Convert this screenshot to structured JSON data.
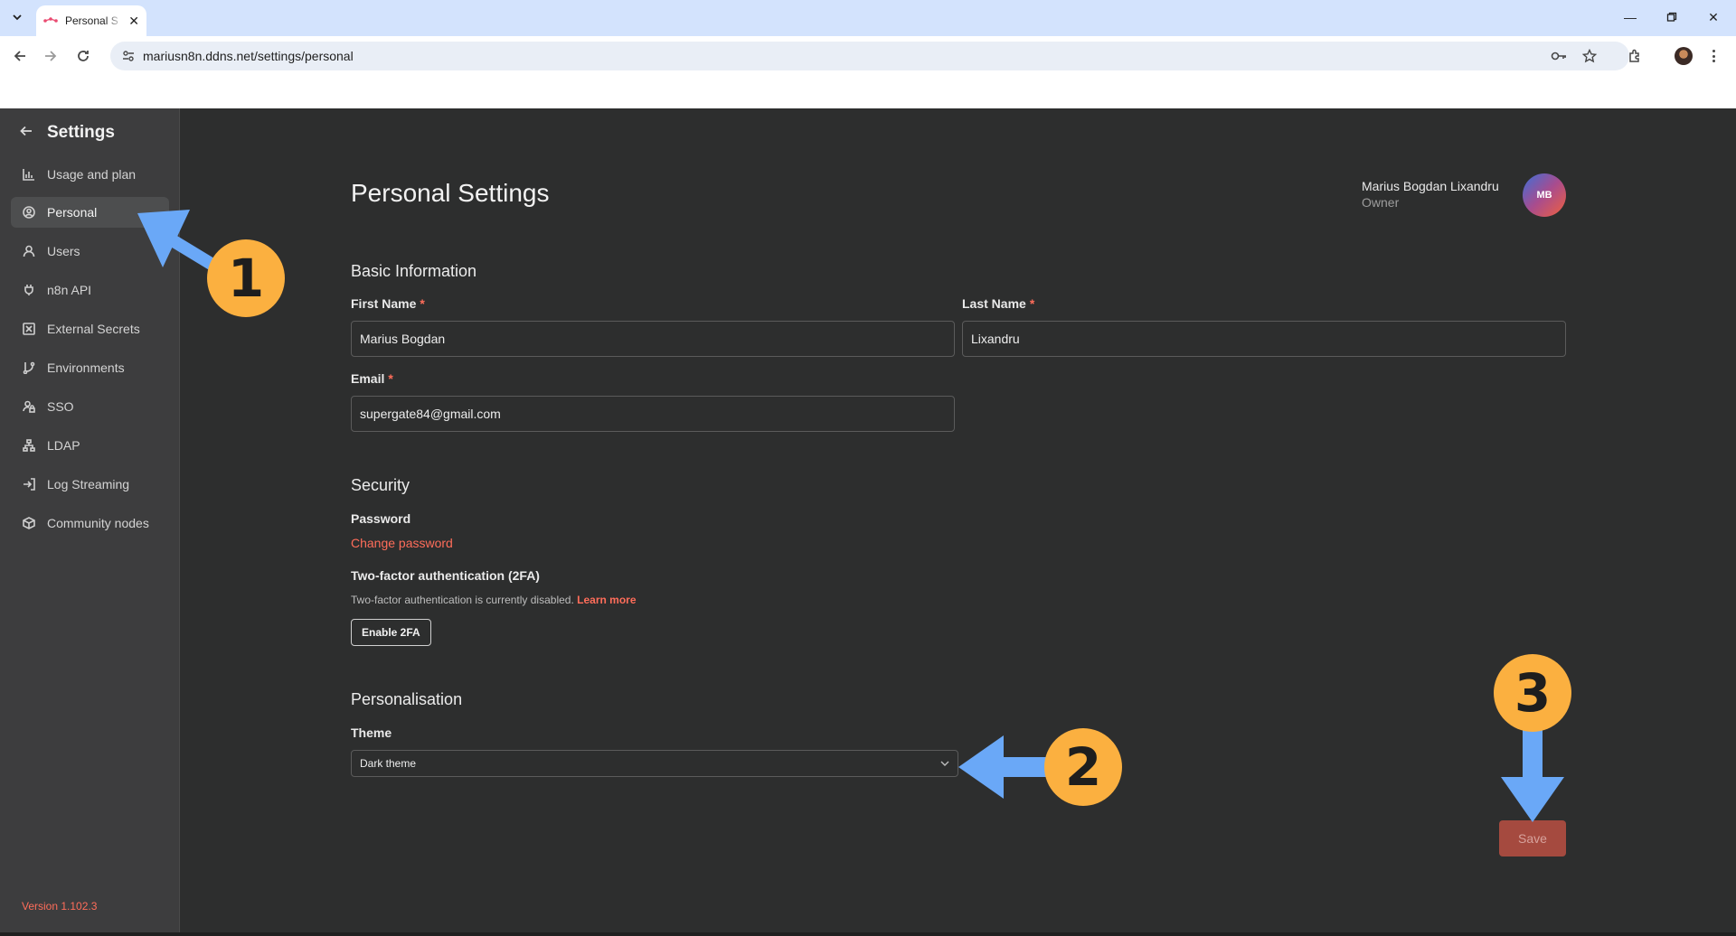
{
  "browser": {
    "tab_title": "Personal S",
    "url": "mariusn8n.ddns.net/settings/personal"
  },
  "sidebar": {
    "title": "Settings",
    "items": [
      {
        "label": "Usage and plan",
        "icon": "chart-bar-icon"
      },
      {
        "label": "Personal",
        "icon": "user-circle-icon",
        "active": true
      },
      {
        "label": "Users",
        "icon": "user-icon"
      },
      {
        "label": "n8n API",
        "icon": "plug-icon"
      },
      {
        "label": "External Secrets",
        "icon": "vault-icon"
      },
      {
        "label": "Environments",
        "icon": "git-branch-icon"
      },
      {
        "label": "SSO",
        "icon": "user-lock-icon"
      },
      {
        "label": "LDAP",
        "icon": "network-icon"
      },
      {
        "label": "Log Streaming",
        "icon": "sign-in-icon"
      },
      {
        "label": "Community nodes",
        "icon": "cube-icon"
      }
    ],
    "version": "Version 1.102.3"
  },
  "page": {
    "title": "Personal Settings",
    "user": {
      "name": "Marius Bogdan Lixandru",
      "role": "Owner",
      "initials": "MB"
    }
  },
  "basic_info": {
    "title": "Basic Information",
    "first_name_label": "First Name",
    "first_name_value": "Marius Bogdan",
    "last_name_label": "Last Name",
    "last_name_value": "Lixandru",
    "email_label": "Email",
    "email_value": "supergate84@gmail.com",
    "required_mark": "*"
  },
  "security": {
    "title": "Security",
    "password_label": "Password",
    "change_password": "Change password",
    "twofa_label": "Two-factor authentication (2FA)",
    "twofa_status": "Two-factor authentication is currently disabled.",
    "learn_more": "Learn more",
    "enable_2fa": "Enable 2FA"
  },
  "personalisation": {
    "title": "Personalisation",
    "theme_label": "Theme",
    "theme_value": "Dark theme"
  },
  "save_label": "Save",
  "annotations": {
    "step1": "1",
    "step2": "2",
    "step3": "3",
    "arrow_color": "#6aa8f7",
    "badge_color": "#fbb040"
  },
  "colors": {
    "accent": "#ff6d5a",
    "background": "#2d2e2e",
    "sidebar": "#3d3d3e"
  }
}
